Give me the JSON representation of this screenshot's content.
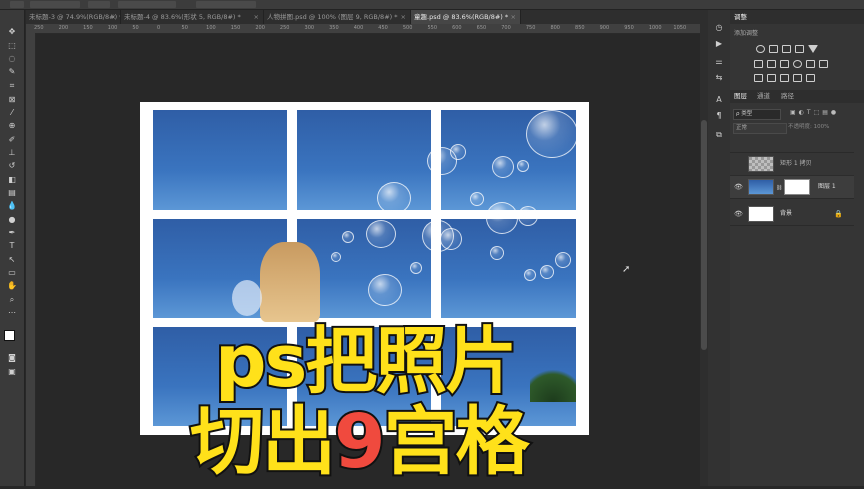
{
  "colors": {
    "caption_yellow": "#ffe11a",
    "caption_red": "#f04a3e",
    "canvas_bg": "#282828",
    "sky": "#3a74bf"
  },
  "doc_tabs": [
    {
      "label": "未标题-3 @ 74.9%(RGB/8#) *"
    },
    {
      "label": "未标题-4 @ 83.6%(形状 5, RGB/8#) *"
    },
    {
      "label": "人物拼图.psd @ 100% (图层 9, RGB/8#) *"
    },
    {
      "label": "童趣.psd @ 83.6%(RGB/8#) *"
    }
  ],
  "ruler_ticks": [
    "250",
    "200",
    "150",
    "100",
    "50",
    "0",
    "50",
    "100",
    "150",
    "200",
    "250",
    "300",
    "350",
    "400",
    "450",
    "500",
    "550",
    "600",
    "650",
    "700",
    "750",
    "800",
    "850",
    "900",
    "950",
    "1000",
    "1050"
  ],
  "adjustments_panel": {
    "tab": "调整",
    "subtitle": "添加调整"
  },
  "layers_panel": {
    "tabs": [
      "图层",
      "通道",
      "路径"
    ],
    "filter_label": "ρ 类型",
    "blend_mode": "正常",
    "opacity_label": "不透明度: 100%",
    "layers": [
      {
        "name": "矩形 1 拷贝"
      },
      {
        "name": "图层 1"
      },
      {
        "name": "背景"
      }
    ]
  },
  "caption": {
    "line1": "ps把照片",
    "line2_part1": "切出",
    "line2_part2": "9",
    "line2_part3": "宫格"
  }
}
